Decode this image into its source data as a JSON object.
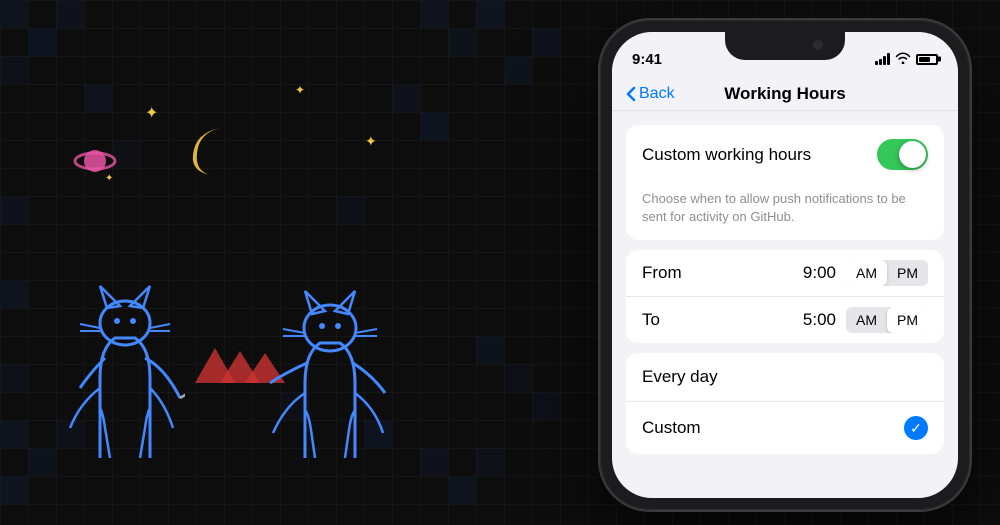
{
  "background": {
    "color": "#0d0d0d"
  },
  "status_bar": {
    "time": "9:41",
    "signal_label": "signal",
    "wifi_label": "wifi",
    "battery_label": "battery"
  },
  "nav": {
    "back_label": "Back",
    "title": "Working Hours"
  },
  "toggle_section": {
    "label": "Custom working hours",
    "enabled": true,
    "description": "Choose when to allow push notifications to be sent for activity on GitHub."
  },
  "time_section": {
    "from_label": "From",
    "from_time": "9:00",
    "from_am_label": "AM",
    "from_pm_label": "PM",
    "from_selected": "AM",
    "to_label": "To",
    "to_time": "5:00",
    "to_am_label": "AM",
    "to_pm_label": "PM",
    "to_selected": "PM"
  },
  "day_section": {
    "items": [
      {
        "label": "Every day",
        "selected": false
      },
      {
        "label": "Custom",
        "selected": true
      }
    ]
  }
}
